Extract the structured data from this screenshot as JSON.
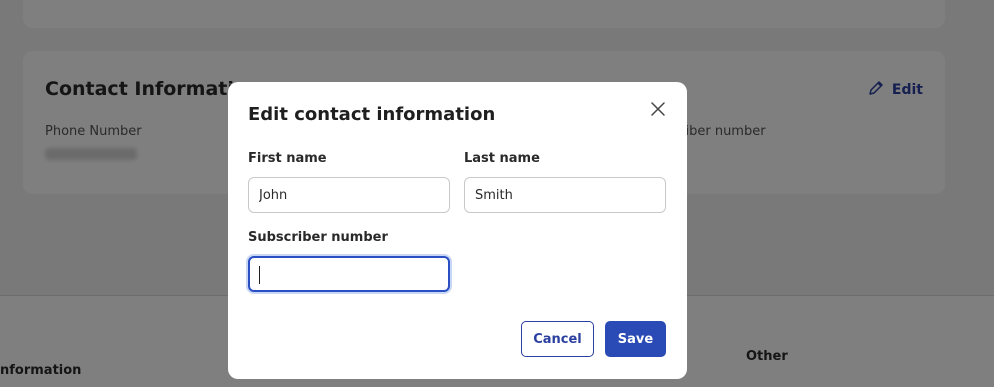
{
  "background": {
    "card": {
      "title": "Contact Information",
      "edit_label": "Edit",
      "phone_label": "Phone Number",
      "subscriber_label_partial": "criber number"
    },
    "bottom": {
      "left_heading_partial": "nformation",
      "right_heading": "Other"
    }
  },
  "modal": {
    "title": "Edit contact information",
    "first_name": {
      "label": "First name",
      "value": "John"
    },
    "last_name": {
      "label": "Last name",
      "value": "Smith"
    },
    "subscriber": {
      "label": "Subscriber number",
      "value": ""
    },
    "cancel_label": "Cancel",
    "save_label": "Save"
  },
  "colors": {
    "accent": "#2a4bb5",
    "focus_ring": "#2a4fc2",
    "overlay": "rgba(0,0,0,0.5)"
  },
  "icons": [
    "pencil-icon",
    "close-icon"
  ]
}
